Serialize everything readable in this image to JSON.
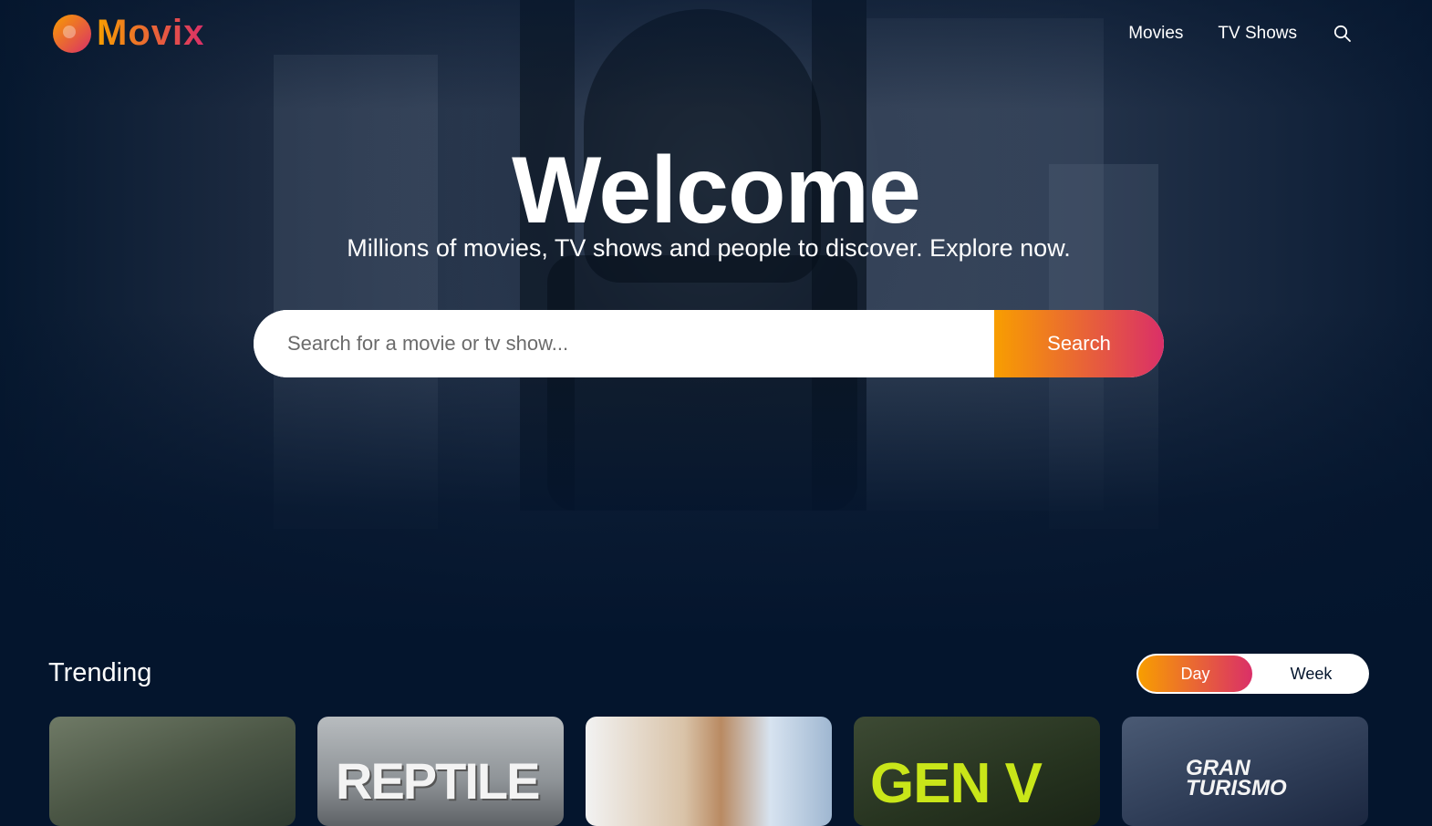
{
  "header": {
    "logo_text": "Movix",
    "nav": [
      "Movies",
      "TV Shows"
    ]
  },
  "hero": {
    "title": "Welcome",
    "subtitle": "Millions of movies, TV shows and people to discover. Explore now.",
    "search_placeholder": "Search for a movie or tv show...",
    "search_button": "Search"
  },
  "trending": {
    "title": "Trending",
    "tabs": [
      "Day",
      "Week"
    ],
    "active_tab": "Day",
    "cards": [
      {
        "poster_text": ""
      },
      {
        "poster_text": "REPTILE"
      },
      {
        "poster_text": ""
      },
      {
        "poster_text": "GEN V"
      },
      {
        "poster_text": "GRAN TURISMO"
      }
    ]
  },
  "colors": {
    "background": "#04152d",
    "accent_start": "#f89e00",
    "accent_end": "#da2f68"
  }
}
